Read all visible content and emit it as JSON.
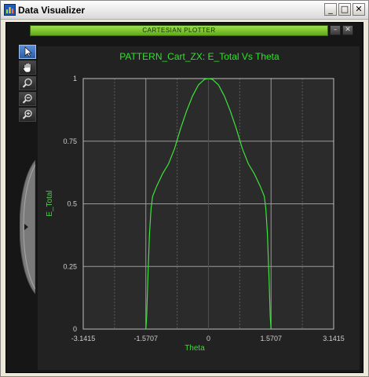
{
  "window": {
    "title": "Data Visualizer",
    "minimize_label": "_",
    "maximize_label": "□",
    "close_label": "✕"
  },
  "panel": {
    "title": "CARTESIAN PLOTTER",
    "minimize_label": "–",
    "close_label": "✕"
  },
  "toolbar": {
    "tools": [
      "pointer-tool",
      "pan-tool",
      "zoom-tool",
      "zoom-out-tool",
      "zoom-in-tool"
    ],
    "active": "pointer-tool"
  },
  "colors": {
    "plot_bg": "#2b2b2b",
    "grid": "#9a9a9a",
    "curve": "#3ee23a",
    "marker": "#d01818",
    "text_green": "#33e030",
    "subbar_green": "#7cc832"
  },
  "chart_data": {
    "type": "line",
    "title": "PATTERN_Cart_ZX: E_Total Vs Theta",
    "xlabel": "Theta",
    "ylabel": "E_Total",
    "xlim": [
      -3.1415,
      3.1415
    ],
    "ylim": [
      0,
      1
    ],
    "x_ticks": [
      "-3.1415",
      "-1.5707",
      "0",
      "1.5707",
      "3.1415"
    ],
    "y_ticks": [
      "0",
      "0.25",
      "0.5",
      "0.75",
      "1"
    ],
    "grid": true,
    "series": [
      {
        "x": [
          -1.5707,
          -1.55,
          -1.52,
          -1.48,
          -1.44,
          -1.4,
          -1.3,
          -1.15,
          -1.0,
          -0.85,
          -0.7,
          -0.55,
          -0.4,
          -0.25,
          -0.1,
          0,
          0.1,
          0.25,
          0.4,
          0.55,
          0.7,
          0.85,
          1.0,
          1.15,
          1.3,
          1.4,
          1.44,
          1.48,
          1.52,
          1.55,
          1.5707
        ],
        "y": [
          0,
          0.05,
          0.2,
          0.38,
          0.48,
          0.53,
          0.57,
          0.62,
          0.66,
          0.72,
          0.8,
          0.87,
          0.93,
          0.975,
          0.997,
          1.0,
          0.997,
          0.975,
          0.93,
          0.87,
          0.8,
          0.72,
          0.66,
          0.62,
          0.57,
          0.53,
          0.48,
          0.38,
          0.2,
          0.05,
          0
        ]
      }
    ],
    "marker_line_x": 0
  }
}
